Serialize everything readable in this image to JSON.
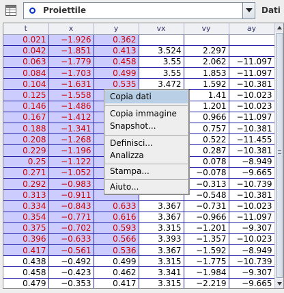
{
  "toolbar": {
    "table_icon": "table-icon",
    "selector": {
      "selected": "Proiettile",
      "icon": "radio-icon",
      "arrow_icon": "chevron-down-icon"
    },
    "data_label": "Dati"
  },
  "colors": {
    "selected_column_bg": "#ccccff",
    "selected_text": "#cc0000",
    "grid_line": "#2222aa",
    "menu_highlight": "#b8cfe5"
  },
  "table": {
    "columns": [
      "t",
      "x",
      "y",
      "vx",
      "vy",
      "ay"
    ],
    "selected_columns": [
      "t",
      "x",
      "y"
    ],
    "rows": [
      [
        "0.021",
        "−1.926",
        "0.362",
        "",
        "",
        ""
      ],
      [
        "0.042",
        "−1.851",
        "0.413",
        "3.524",
        "2.297",
        ""
      ],
      [
        "0.063",
        "−1.779",
        "0.458",
        "3.55",
        "2.062",
        "−11.097"
      ],
      [
        "0.084",
        "−1.703",
        "0.499",
        "3.55",
        "1.853",
        "−11.097"
      ],
      [
        "0.104",
        "−1.631",
        "0.535",
        "3.472",
        "1.592",
        "−10.381"
      ],
      [
        "0.125",
        "−1.558",
        "",
        "",
        "1.41",
        "−10.023"
      ],
      [
        "0.146",
        "−1.486",
        "",
        "",
        "1.201",
        "−10.023"
      ],
      [
        "0.167",
        "−1.412",
        "",
        "",
        "0.966",
        "−11.097"
      ],
      [
        "0.188",
        "−1.341",
        "",
        "",
        "0.757",
        "−10.381"
      ],
      [
        "0.208",
        "−1.268",
        "",
        "",
        "0.522",
        "−11.455"
      ],
      [
        "0.229",
        "−1.196",
        "",
        "",
        "0.287",
        "−10.381"
      ],
      [
        "0.25",
        "−1.122",
        "",
        "",
        "0.078",
        "−8.949"
      ],
      [
        "0.271",
        "−1.052",
        "",
        "",
        "−0.078",
        "−9.665"
      ],
      [
        "0.292",
        "−0.983",
        "",
        "",
        "−0.313",
        "−10.739"
      ],
      [
        "0.313",
        "−0.911",
        "",
        "",
        "−0.548",
        "−10.381"
      ],
      [
        "0.334",
        "−0.843",
        "0.633",
        "3.367",
        "−0.731",
        "−10.023"
      ],
      [
        "0.354",
        "−0.771",
        "0.616",
        "3.367",
        "−0.966",
        "−11.097"
      ],
      [
        "0.375",
        "−0.702",
        "0.593",
        "3.315",
        "−1.201",
        "−9.307"
      ],
      [
        "0.396",
        "−0.633",
        "0.566",
        "3.393",
        "−1.357",
        "−10.023"
      ],
      [
        "0.417",
        "−0.561",
        "0.536",
        "3.367",
        "−1.592",
        "−8.949"
      ],
      [
        "0.438",
        "−0.492",
        "0.499",
        "3.315",
        "−1.775",
        "−10.739"
      ],
      [
        "0.458",
        "−0.423",
        "0.462",
        "3.341",
        "−1.984",
        "−9.307"
      ],
      [
        "0.479",
        "−0.353",
        "0.417",
        "3.315",
        "−2.219",
        "−9.665"
      ]
    ],
    "highlighted_row_count": 20,
    "scrollbar": {
      "up_icon": "arrow-up-icon",
      "down_icon": "arrow-down-icon"
    }
  },
  "context_menu": {
    "highlighted": "Copia dati",
    "groups": [
      [
        "Copia dati"
      ],
      [
        "Copia immagine",
        "Snapshot..."
      ],
      [
        "Definisci...",
        "Analizza"
      ],
      [
        "Stampa..."
      ],
      [
        "Aiuto..."
      ]
    ]
  }
}
